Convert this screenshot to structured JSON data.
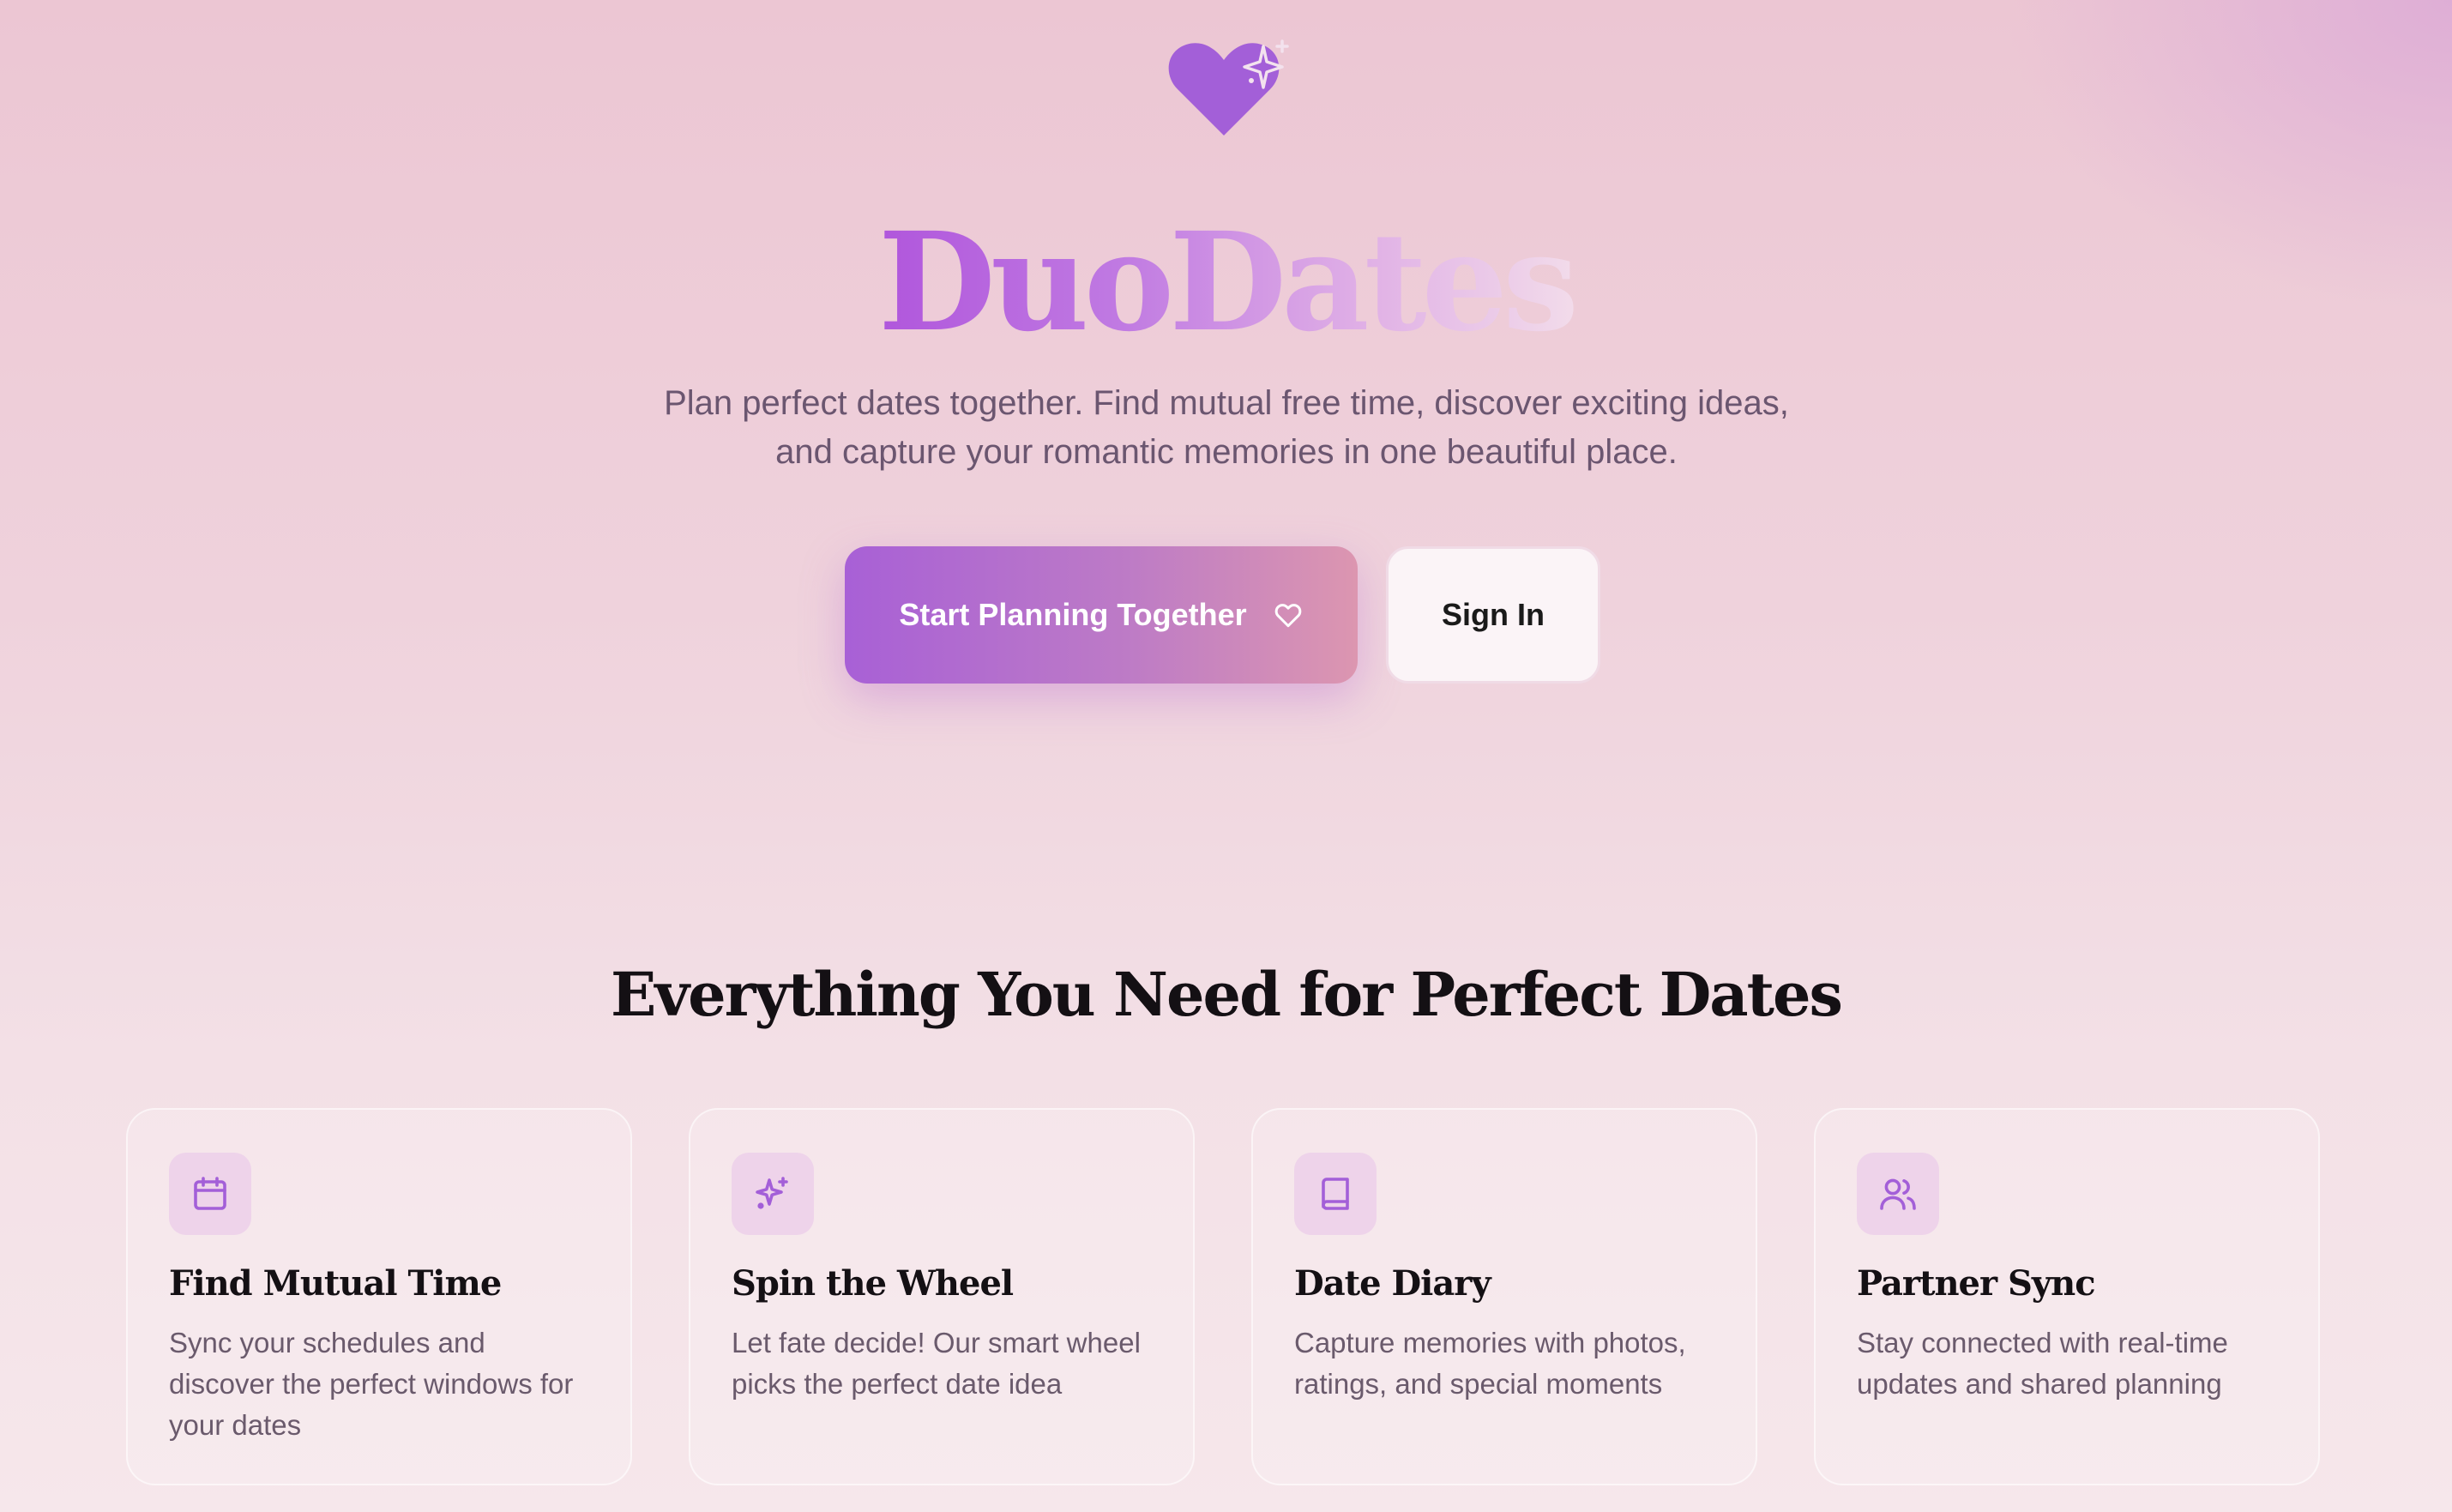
{
  "brand": {
    "name": "DuoDates",
    "tagline": "Plan perfect dates together. Find mutual free time, discover exciting ideas, and capture your romantic memories in one beautiful place.",
    "logo_icon": "heart-sparkle-icon"
  },
  "actions": {
    "primary_label": "Start Planning Together",
    "primary_icon": "heart-outline-icon",
    "secondary_label": "Sign In"
  },
  "features": {
    "heading": "Everything You Need for Perfect Dates",
    "items": [
      {
        "icon": "calendar-icon",
        "title": "Find Mutual Time",
        "description": "Sync your schedules and discover the perfect windows for your dates"
      },
      {
        "icon": "sparkles-icon",
        "title": "Spin the Wheel",
        "description": "Let fate decide! Our smart wheel picks the perfect date idea"
      },
      {
        "icon": "book-icon",
        "title": "Date Diary",
        "description": "Capture memories with photos, ratings, and special moments"
      },
      {
        "icon": "users-icon",
        "title": "Partner Sync",
        "description": "Stay connected with real-time updates and shared planning"
      }
    ]
  },
  "colors": {
    "accent": "#a35fd8",
    "gradient_start": "#a860d6",
    "gradient_end": "#dc96b0",
    "background_top": "#ecc6d3",
    "background_bottom": "#f6e7eb",
    "icon_tile": "#eed3ea"
  }
}
